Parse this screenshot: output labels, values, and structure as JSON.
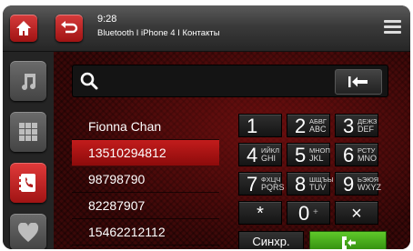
{
  "status": {
    "time": "9:28",
    "line": "Bluetooth I iPhone 4 I Контакты"
  },
  "icons": {
    "home": "home-icon",
    "back": "back-arrow-icon",
    "menu": "menu-icon",
    "music": "music-note-icon",
    "apps": "grid-icon",
    "contacts": "phonebook-icon",
    "favorites": "heart-icon",
    "search": "search-icon",
    "backspace": "backspace-icon",
    "call": "call-icon"
  },
  "search": {
    "value": "",
    "placeholder": ""
  },
  "contacts": [
    "Fionna Chan",
    "13510294812",
    "98798790",
    "82287907",
    "15462212112"
  ],
  "keypad": [
    {
      "digit": "1",
      "letters": ""
    },
    {
      "digit": "2",
      "letters": "АБВГ ABC"
    },
    {
      "digit": "3",
      "letters": "ДЕЖЗ DEF"
    },
    {
      "digit": "4",
      "letters": "ИЙКЛ GHI"
    },
    {
      "digit": "5",
      "letters": "МНОП JKL"
    },
    {
      "digit": "6",
      "letters": "РСТУ MNO"
    },
    {
      "digit": "7",
      "letters": "ФХЦЧ PQRS"
    },
    {
      "digit": "8",
      "letters": "ШЩЪЫ TUV"
    },
    {
      "digit": "9",
      "letters": "ЬЭЮЯ WXYZ"
    },
    {
      "digit": "*",
      "letters": ""
    },
    {
      "digit": "0",
      "letters": "+"
    },
    {
      "digit": "×",
      "letters": ""
    }
  ],
  "buttons": {
    "sync": "Синхр."
  },
  "colors": {
    "accent": "#c21c1c",
    "call": "#4aa81d"
  }
}
